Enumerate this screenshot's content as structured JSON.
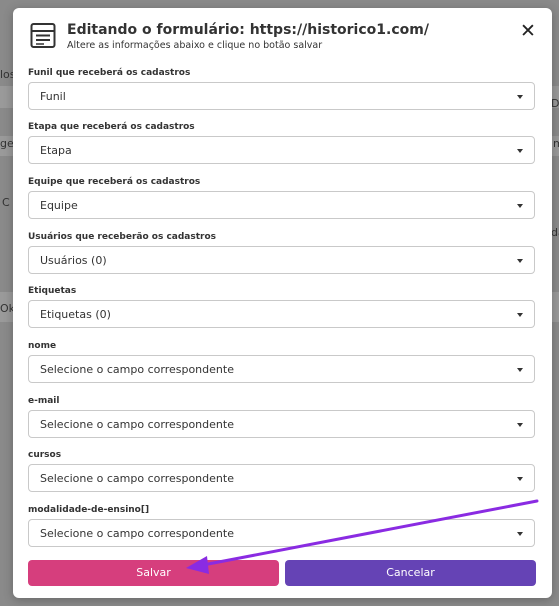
{
  "background": {
    "fragments": [
      "los",
      "De",
      "ge",
      "mi",
      "C",
      "da",
      "Ok"
    ]
  },
  "modal": {
    "title": "Editando o formulário: https://historico1.com/",
    "subtitle": "Altere as informações abaixo e clique no botão salvar",
    "close_label": "✕",
    "fields": [
      {
        "label": "Funil que receberá os cadastros",
        "value": "Funil"
      },
      {
        "label": "Etapa que receberá os cadastros",
        "value": "Etapa"
      },
      {
        "label": "Equipe que receberá os cadastros",
        "value": "Equipe"
      },
      {
        "label": "Usuários que receberão os cadastros",
        "value": "Usuários (0)"
      },
      {
        "label": "Etiquetas",
        "value": "Etiquetas (0)"
      },
      {
        "label": "nome",
        "value": "Selecione o campo correspondente"
      },
      {
        "label": "e-mail",
        "value": "Selecione o campo correspondente"
      },
      {
        "label": "cursos",
        "value": "Selecione o campo correspondente"
      },
      {
        "label": "modalidade-de-ensino[]",
        "value": "Selecione o campo correspondente"
      }
    ],
    "save_label": "Salvar",
    "cancel_label": "Cancelar"
  },
  "colors": {
    "save": "#d63e7d",
    "cancel": "#6543b5",
    "annotation_arrow": "#8a2be2"
  }
}
